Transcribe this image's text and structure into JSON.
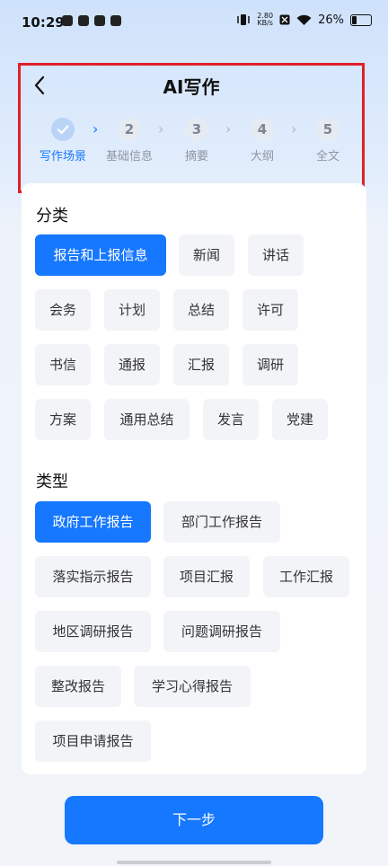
{
  "status_bar": {
    "time": "10:29",
    "net_speed_top": "2.80",
    "net_speed_unit": "KB/s",
    "battery": "26%"
  },
  "header": {
    "title": "AI写作"
  },
  "steps": [
    {
      "num": "",
      "label": "写作场景"
    },
    {
      "num": "2",
      "label": "基础信息"
    },
    {
      "num": "3",
      "label": "摘要"
    },
    {
      "num": "4",
      "label": "大纲"
    },
    {
      "num": "5",
      "label": "全文"
    }
  ],
  "category": {
    "title": "分类",
    "items": [
      "报告和上报信息",
      "新闻",
      "讲话",
      "会务",
      "计划",
      "总结",
      "许可",
      "书信",
      "通报",
      "汇报",
      "调研",
      "方案",
      "通用总结",
      "发言",
      "党建"
    ]
  },
  "type": {
    "title": "类型",
    "items": [
      "政府工作报告",
      "部门工作报告",
      "落实指示报告",
      "项目汇报",
      "工作汇报",
      "地区调研报告",
      "问题调研报告",
      "整改报告",
      "学习心得报告",
      "项目申请报告"
    ]
  },
  "next_button": "下一步",
  "colors": {
    "accent": "#1677ff",
    "highlight_border": "#e0202a"
  }
}
